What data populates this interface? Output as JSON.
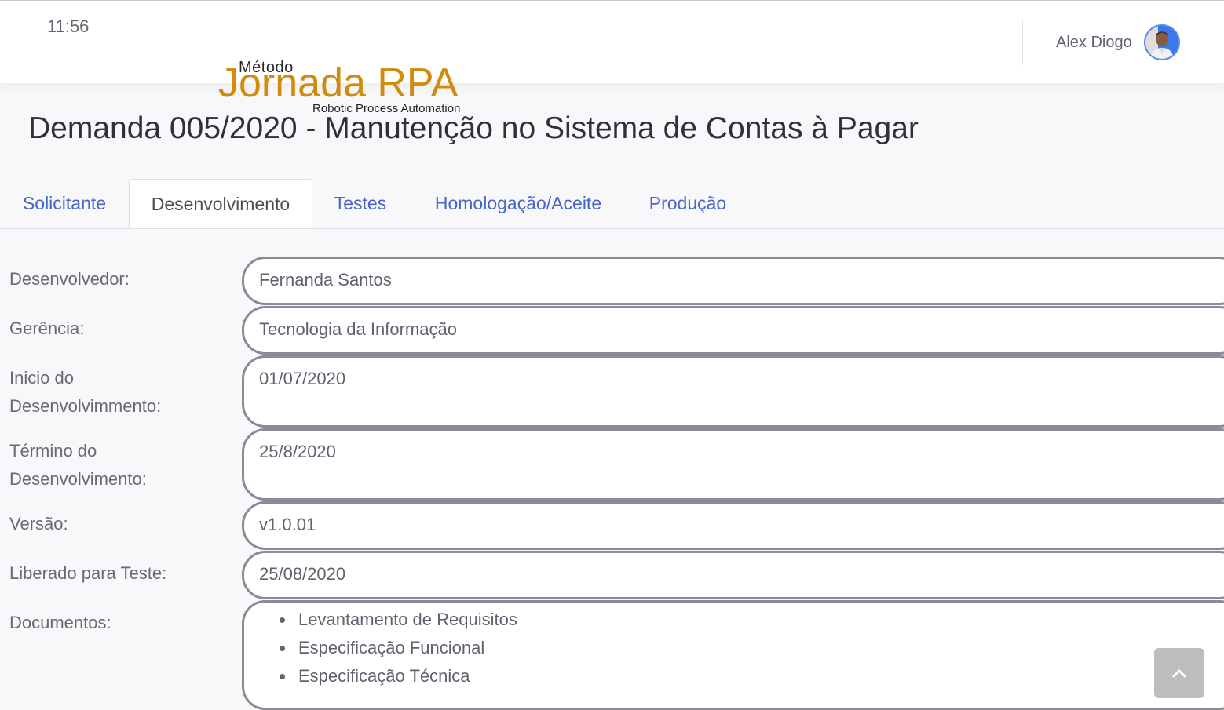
{
  "header": {
    "time": "11:56",
    "user_name": "Alex Diogo"
  },
  "logo": {
    "top_text": "Método",
    "main_text": "Jornada RPA",
    "sub_text": "Robotic Process Automation"
  },
  "page": {
    "title": "Demanda 005/2020 - Manutenção no Sistema de Contas à Pagar"
  },
  "tabs": [
    {
      "label": "Solicitante",
      "active": false
    },
    {
      "label": "Desenvolvimento",
      "active": true
    },
    {
      "label": "Testes",
      "active": false
    },
    {
      "label": "Homologação/Aceite",
      "active": false
    },
    {
      "label": "Produção",
      "active": false
    }
  ],
  "form": {
    "desenvolvedor": {
      "label": "Desenvolvedor:",
      "value": "Fernanda Santos"
    },
    "gerencia": {
      "label": "Gerência:",
      "value": "Tecnologia da Informação"
    },
    "inicio": {
      "label_line1": "Inicio do",
      "label_line2": "Desenvolvimmento:",
      "value": "01/07/2020"
    },
    "termino": {
      "label_line1": "Término do",
      "label_line2": "Desenvolvimento:",
      "value": "25/8/2020"
    },
    "versao": {
      "label": "Versão:",
      "value": "v1.0.01"
    },
    "liberado": {
      "label": "Liberado para Teste:",
      "value": "25/08/2020"
    },
    "documentos": {
      "label": "Documentos:",
      "items": [
        "Levantamento de Requisitos",
        "Especificação Funcional",
        "Especificação Técnica"
      ]
    }
  },
  "icons": {
    "avatar": "user-avatar",
    "scroll_top": "chevron-up-icon"
  },
  "colors": {
    "logo_orange": "#d28b0e",
    "tab_link": "#4764c7",
    "field_border": "#8a8b96"
  }
}
